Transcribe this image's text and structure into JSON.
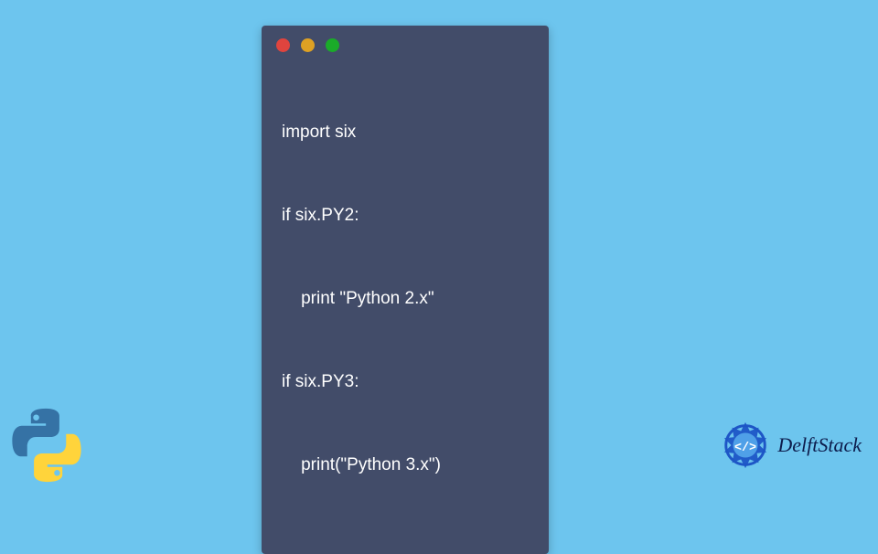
{
  "code_window": {
    "lines": [
      "import six",
      "if six.PY2:",
      "    print \"Python 2.x\"",
      "if six.PY3:",
      "    print(\"Python 3.x\")"
    ]
  },
  "brand": {
    "name": "DelftStack"
  },
  "colors": {
    "background": "#6DC5EE",
    "window": "#424C69",
    "red": "#E0443E",
    "yellow": "#DEA123",
    "green": "#1AAB29"
  }
}
